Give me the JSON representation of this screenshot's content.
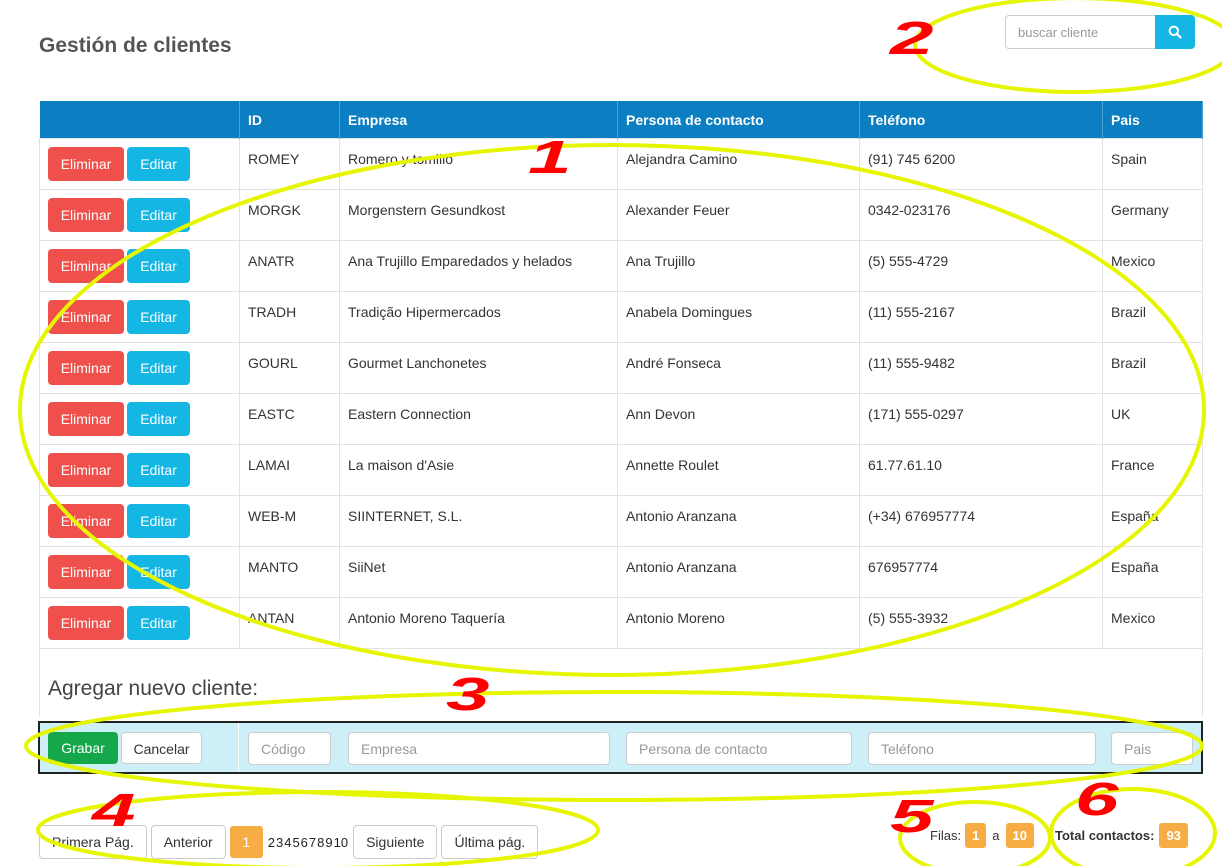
{
  "page": {
    "title": "Gestión de clientes"
  },
  "search": {
    "placeholder": "buscar cliente",
    "icon": "search-icon"
  },
  "table": {
    "headers": [
      "",
      "ID",
      "Empresa",
      "Persona de contacto",
      "Teléfono",
      "Pais"
    ],
    "delete_label": "Eliminar",
    "edit_label": "Editar",
    "rows": [
      {
        "id": "ROMEY",
        "empresa": "Romero y tomillo",
        "contacto": "Alejandra Camino",
        "telefono": "(91) 745 6200",
        "pais": "Spain"
      },
      {
        "id": "MORGK",
        "empresa": "Morgenstern Gesundkost",
        "contacto": "Alexander Feuer",
        "telefono": "0342-023176",
        "pais": "Germany"
      },
      {
        "id": "ANATR",
        "empresa": "Ana Trujillo Emparedados y helados",
        "contacto": "Ana Trujillo",
        "telefono": "(5) 555-4729",
        "pais": "Mexico"
      },
      {
        "id": "TRADH",
        "empresa": "Tradição Hipermercados",
        "contacto": "Anabela Domingues",
        "telefono": "(11) 555-2167",
        "pais": "Brazil"
      },
      {
        "id": "GOURL",
        "empresa": "Gourmet Lanchonetes",
        "contacto": "André Fonseca",
        "telefono": "(11) 555-9482",
        "pais": "Brazil"
      },
      {
        "id": "EASTC",
        "empresa": "Eastern Connection",
        "contacto": "Ann Devon",
        "telefono": "(171) 555-0297",
        "pais": "UK"
      },
      {
        "id": "LAMAI",
        "empresa": "La maison d'Asie",
        "contacto": "Annette Roulet",
        "telefono": "61.77.61.10",
        "pais": "France"
      },
      {
        "id": "WEB-M",
        "empresa": "SIINTERNET, S.L.",
        "contacto": "Antonio Aranzana",
        "telefono": "(+34) 676957774",
        "pais": "España"
      },
      {
        "id": "MANTO",
        "empresa": "SiiNet",
        "contacto": "Antonio Aranzana",
        "telefono": "676957774",
        "pais": "España"
      },
      {
        "id": "ANTAN",
        "empresa": "Antonio Moreno Taquería",
        "contacto": "Antonio Moreno",
        "telefono": "(5) 555-3932",
        "pais": "Mexico"
      }
    ]
  },
  "add": {
    "title": "Agregar nuevo cliente:",
    "save_label": "Grabar",
    "cancel_label": "Cancelar",
    "placeholders": {
      "codigo": "Código",
      "empresa": "Empresa",
      "contacto": "Persona de contacto",
      "telefono": "Teléfono",
      "pais": "Pais"
    }
  },
  "pager": {
    "first": "Primera Pág.",
    "prev": "Anterior",
    "current": "1",
    "pages": [
      "2",
      "3",
      "4",
      "5",
      "6",
      "7",
      "8",
      "9",
      "10"
    ],
    "next": "Siguiente",
    "last": "Última pág."
  },
  "rows_info": {
    "label": "Filas:",
    "from": "1",
    "sep": "a",
    "to": "10"
  },
  "total": {
    "label": "Total contactos:",
    "value": "93"
  },
  "annotations": {
    "markers": [
      "1",
      "2",
      "3",
      "4",
      "5",
      "6"
    ],
    "ellipse_color": "#e6f500",
    "marker_color": "#ff0000"
  }
}
